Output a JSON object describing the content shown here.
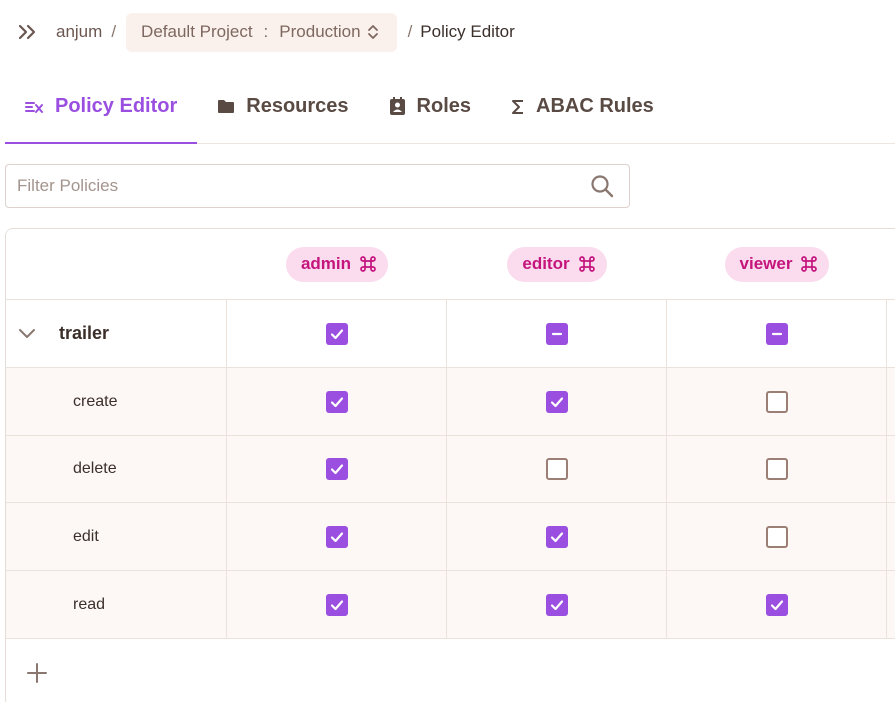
{
  "breadcrumb": {
    "user": "anjum",
    "separator": "/",
    "project": "Default Project",
    "colon": ":",
    "environment": "Production",
    "current": "Policy Editor"
  },
  "tabs": [
    {
      "label": "Policy Editor",
      "icon": "policy-editor-icon",
      "active": true
    },
    {
      "label": "Resources",
      "icon": "folder-icon",
      "active": false
    },
    {
      "label": "Roles",
      "icon": "contact-card-icon",
      "active": false
    },
    {
      "label": "ABAC Rules",
      "icon": "sigma-icon",
      "active": false
    }
  ],
  "filter": {
    "placeholder": "Filter Policies",
    "value": ""
  },
  "roles": [
    {
      "name": "admin",
      "icon": "command-icon"
    },
    {
      "name": "editor",
      "icon": "command-icon"
    },
    {
      "name": "viewer",
      "icon": "command-icon"
    }
  ],
  "resources": [
    {
      "name": "trailer",
      "expanded": true,
      "state": [
        "checked",
        "partial",
        "partial"
      ],
      "actions": [
        {
          "name": "create",
          "state": [
            "checked",
            "checked",
            "unchecked"
          ]
        },
        {
          "name": "delete",
          "state": [
            "checked",
            "unchecked",
            "unchecked"
          ]
        },
        {
          "name": "edit",
          "state": [
            "checked",
            "checked",
            "unchecked"
          ]
        },
        {
          "name": "read",
          "state": [
            "checked",
            "checked",
            "checked"
          ]
        }
      ]
    }
  ],
  "colors": {
    "accent": "#9a4fe0",
    "role_pill_bg": "#fbdcee",
    "role_pill_text": "#c4157d",
    "checkbox_border": "#9c7f74",
    "child_row_bg": "#fdf8f5"
  }
}
